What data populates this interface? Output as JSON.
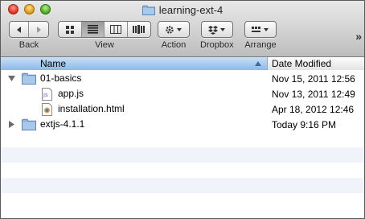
{
  "window": {
    "title": "learning-ext-4"
  },
  "toolbar": {
    "back_label": "Back",
    "view_label": "View",
    "action_label": "Action",
    "dropbox_label": "Dropbox",
    "arrange_label": "Arrange"
  },
  "columns": {
    "name": "Name",
    "date_modified": "Date Modified"
  },
  "files": [
    {
      "name": "01-basics",
      "date": "Nov 15, 2011 12:56",
      "kind": "folder",
      "expanded": true,
      "depth": 0
    },
    {
      "name": "app.js",
      "date": "Nov 13, 2011 12:49",
      "kind": "js",
      "depth": 1
    },
    {
      "name": "installation.html",
      "date": "Apr 18, 2012 12:46",
      "kind": "html",
      "depth": 1
    },
    {
      "name": "extjs-4.1.1",
      "date": "Today 9:16 PM",
      "kind": "folder",
      "expanded": false,
      "depth": 0
    }
  ],
  "colors": {
    "header_selected": "#8eb9e6",
    "folder": "#8fb6e0",
    "alt_row": "#f0f4fa"
  }
}
